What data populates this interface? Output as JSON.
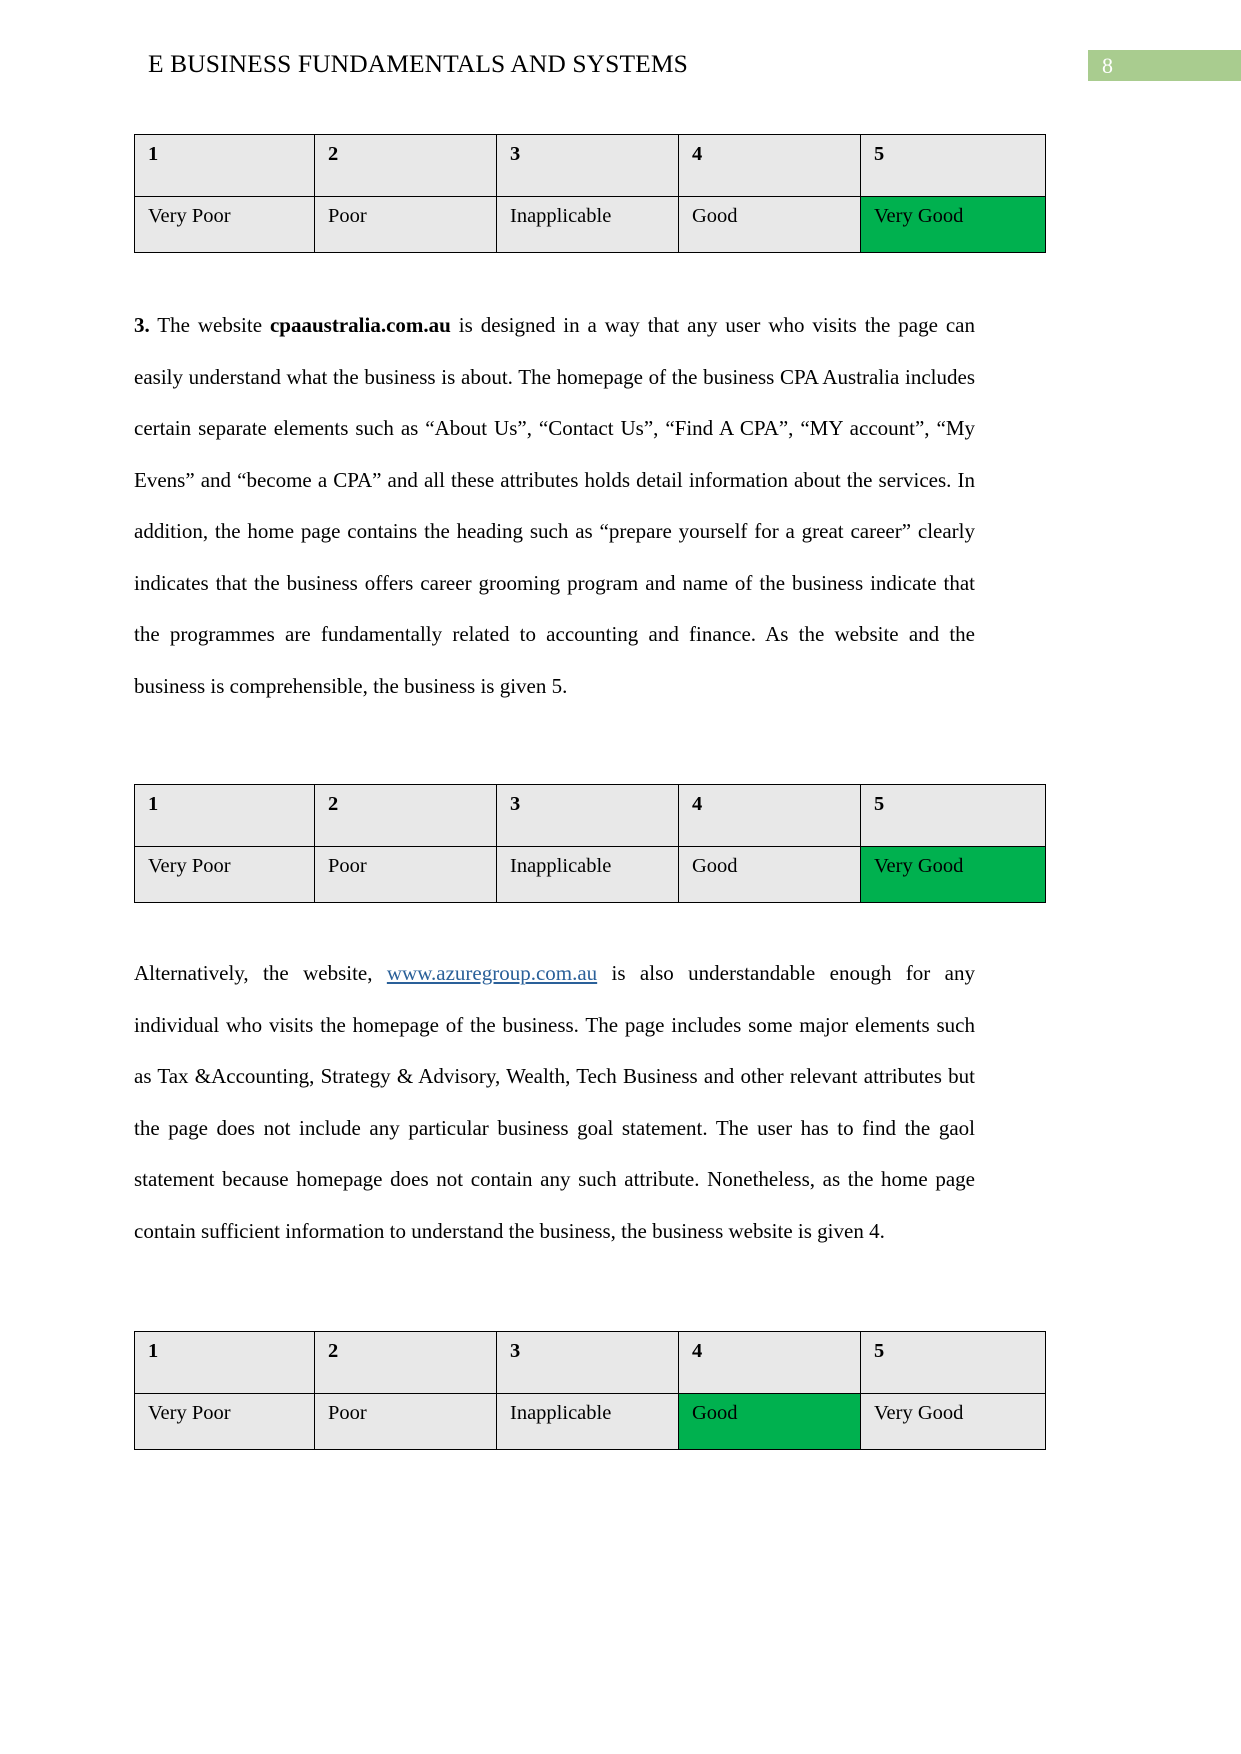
{
  "header": {
    "title": "E BUSINESS FUNDAMENTALS AND SYSTEMS",
    "page_number": "8",
    "badge_color": "#A9CC8F"
  },
  "colors": {
    "selected_cell": "#00B14F",
    "table_background": "#E8E8E8",
    "link": "#2A6099"
  },
  "rating_scale": {
    "numbers": [
      "1",
      "2",
      "3",
      "4",
      "5"
    ],
    "labels": [
      "Very Poor",
      "Poor",
      "Inapplicable",
      "Good",
      "Very Good"
    ]
  },
  "tables": [
    {
      "name": "rating-table-1",
      "numbers": [
        "1",
        "2",
        "3",
        "4",
        "5"
      ],
      "labels": [
        "Very Poor",
        "Poor",
        "Inapplicable",
        "Good",
        "Very Good"
      ],
      "selected_index": 4,
      "selected_label": "Very Good"
    },
    {
      "name": "rating-table-2",
      "numbers": [
        "1",
        "2",
        "3",
        "4",
        "5"
      ],
      "labels": [
        "Very Poor",
        "Poor",
        "Inapplicable",
        "Good",
        "Very Good"
      ],
      "selected_index": 4,
      "selected_label": "Very Good"
    },
    {
      "name": "rating-table-3",
      "numbers": [
        "1",
        "2",
        "3",
        "4",
        "5"
      ],
      "labels": [
        "Very Poor",
        "Poor",
        "Inapplicable",
        "Good",
        "Very Good"
      ],
      "selected_index": 3,
      "selected_label": "Good"
    }
  ],
  "paragraphs": {
    "item_3": {
      "number": "3.",
      "lead": " The website ",
      "bold_site": "cpaaustralia.com.au",
      "body": " is designed in a way that any user who visits the page can easily understand what the business is about. The homepage of the business CPA Australia includes certain separate elements such as “About Us”, “Contact Us”, “Find A CPA”, “MY account”, “My Evens” and “become a CPA” and all these attributes holds detail information about the services. In addition, the home page contains the heading such as “prepare yourself for a great career” clearly indicates that the business offers career grooming program and name of the business indicate that the programmes are fundamentally related to accounting and finance. As the website and the business is comprehensible, the business is given 5."
    },
    "alternative": {
      "lead": "Alternatively, the website, ",
      "link_text": "www.azuregroup.com.au",
      "body": " is also understandable enough for any individual who visits the homepage of the business. The page includes some major elements such as Tax &Accounting, Strategy & Advisory, Wealth, Tech Business and other relevant attributes but the page does not include any particular business goal statement. The user has to find the gaol statement because homepage does not contain any such attribute. Nonetheless, as the home page contain sufficient information to understand the business, the business website is given 4."
    }
  }
}
